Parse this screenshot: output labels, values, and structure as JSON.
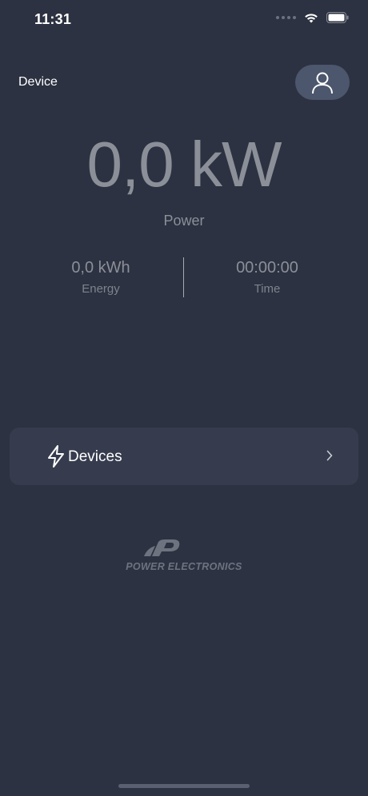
{
  "status_bar": {
    "time": "11:31"
  },
  "header": {
    "title": "Device",
    "profile_icon": "person-icon"
  },
  "power": {
    "value": "0,0 kW",
    "label": "Power"
  },
  "metrics": {
    "energy": {
      "value": "0,0 kWh",
      "label": "Energy"
    },
    "time": {
      "value": "00:00:00",
      "label": "Time"
    }
  },
  "devices_card": {
    "label": "Devices",
    "icon": "lightning-bolt-icon",
    "chevron_icon": "chevron-right-icon"
  },
  "logo": {
    "text": "POWER ELECTRONICS"
  },
  "colors": {
    "background": "#2c3241",
    "card": "#363c4e",
    "profile_button": "#4c566c",
    "muted_text": "#8b8f98"
  }
}
